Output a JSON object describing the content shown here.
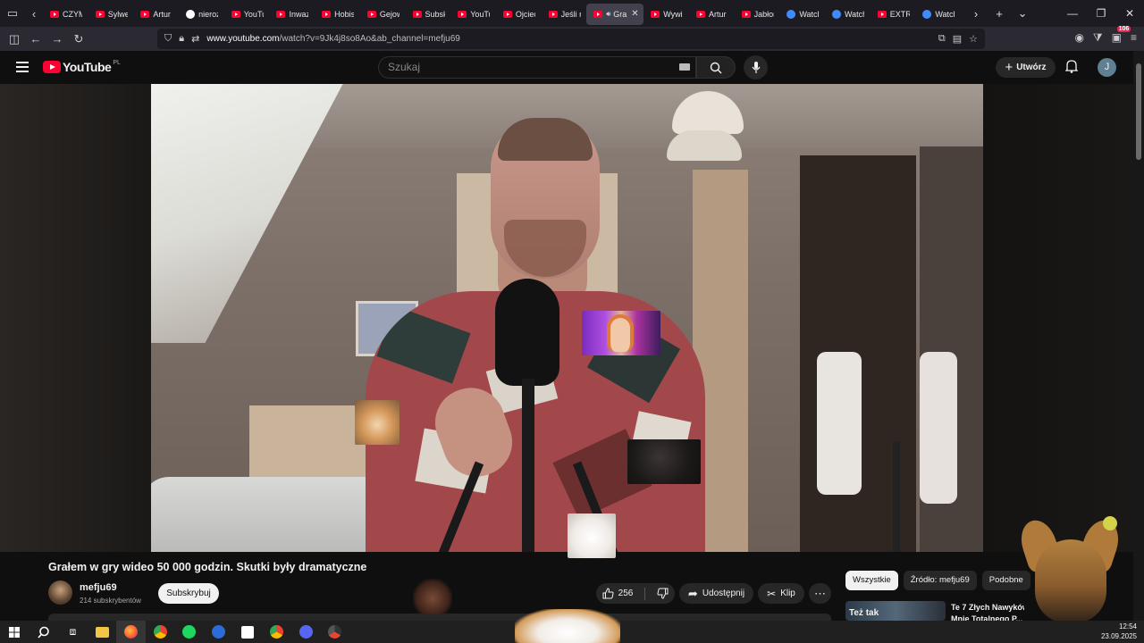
{
  "browser": {
    "tabs": [
      {
        "label": "CZYM",
        "icon": "youtube-icon"
      },
      {
        "label": "Sylwe",
        "icon": "youtube-icon"
      },
      {
        "label": "Artur",
        "icon": "youtube-icon"
      },
      {
        "label": "nieroz",
        "icon": "google-icon"
      },
      {
        "label": "YouTu",
        "icon": "youtube-icon"
      },
      {
        "label": "Inwaz",
        "icon": "youtube-icon"
      },
      {
        "label": "Hobis",
        "icon": "youtube-icon"
      },
      {
        "label": "Gejow",
        "icon": "youtube-icon"
      },
      {
        "label": "Subsk",
        "icon": "youtube-icon"
      },
      {
        "label": "YouTu",
        "icon": "youtube-icon"
      },
      {
        "label": "Ojciec",
        "icon": "youtube-icon"
      },
      {
        "label": "Jeśli n",
        "icon": "youtube-icon"
      },
      {
        "label": "Gra",
        "icon": "youtube-icon",
        "active": true
      },
      {
        "label": "Wywia",
        "icon": "youtube-icon"
      },
      {
        "label": "Artur",
        "icon": "youtube-icon"
      },
      {
        "label": "Jabłon",
        "icon": "youtube-icon"
      },
      {
        "label": "Watch",
        "icon": "watch-icon"
      },
      {
        "label": "Watch",
        "icon": "watch-icon"
      },
      {
        "label": "EXTRE",
        "icon": "youtube-icon"
      },
      {
        "label": "Watch",
        "icon": "watch-icon"
      }
    ],
    "url_host": "www.youtube.com",
    "url_rest": "/watch?v=9Jk4j8so8Ao&ab_channel=mefju69",
    "extensions_badge": "106"
  },
  "youtube": {
    "logo_text": "YouTube",
    "region": "PL",
    "search_placeholder": "Szukaj",
    "create_label": "Utwórz",
    "avatar_letter": "J",
    "accent_color": "#ff0033"
  },
  "video": {
    "title": "Grałem w gry wideo 50 000 godzin. Skutki były dramatyczne",
    "channel": "mefju69",
    "subscribers": "214 subskrybentów",
    "subscribe_label": "Subskrybuj",
    "likes": "256",
    "share_label": "Udostępnij",
    "clip_label": "Klip"
  },
  "sidebar": {
    "chips": [
      {
        "label": "Wszystkie",
        "active": true
      },
      {
        "label": "Źródło: mefju69",
        "active": false
      },
      {
        "label": "Podobne",
        "active": false
      }
    ],
    "recommendation": {
      "thumb_text": "Też tak",
      "title_line1": "Te 7 Złych Nawyków",
      "title_line2": "Mnie Totalnego P..."
    }
  },
  "taskbar": {
    "time": "12:54",
    "date": "23.09.2025",
    "apps": [
      "windows-start-icon",
      "search-icon",
      "task-view-icon",
      "file-explorer-icon",
      "firefox-icon",
      "chrome-icon",
      "spotify-icon",
      "app-icon",
      "app-icon",
      "chrome-icon",
      "discord-icon",
      "chrome-icon"
    ]
  }
}
